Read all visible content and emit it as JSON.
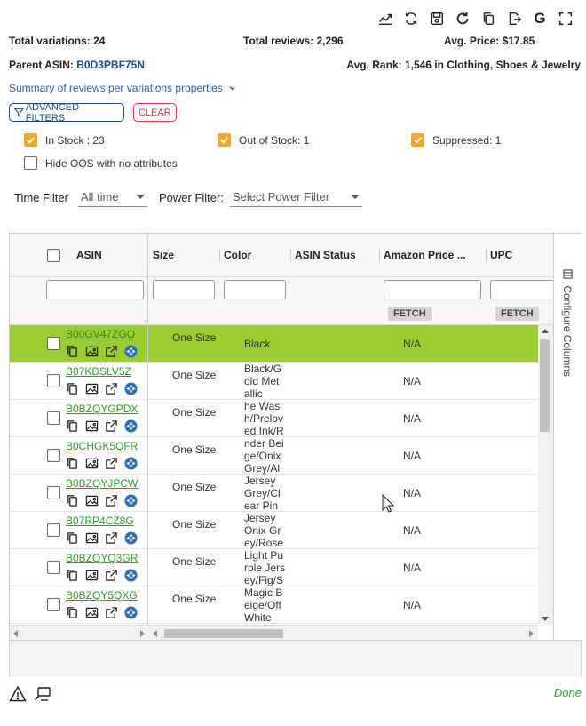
{
  "toolbar": {
    "icons": [
      "trend-chart-icon",
      "sync-icon",
      "save-icon",
      "refresh-icon",
      "copy-icon",
      "export-icon",
      "google-icon",
      "fullscreen-icon"
    ],
    "google_label": "G"
  },
  "stats": {
    "total_variations": "Total variations: 24",
    "total_reviews": "Total reviews: 2,296",
    "avg_price": "Avg. Price: $17.85",
    "parent_asin_label": "Parent ASIN: ",
    "parent_asin": "B0D3PBF75N",
    "avg_rank": "Avg. Rank: 1,546 in Clothing, Shoes & Jewelry"
  },
  "summary_link": "Summary of reviews per variations properties",
  "buttons": {
    "advanced_filters": "ADVANCED FILTERS",
    "clear": "CLEAR"
  },
  "checkboxes": {
    "in_stock": "In Stock : 23",
    "out_of_stock": "Out of Stock: 1",
    "suppressed": "Suppressed: 1",
    "hide_oos": "Hide OOS with no attributes"
  },
  "filters": {
    "time_label": "Time Filter",
    "time_value": "All time",
    "power_label": "Power Filter:",
    "power_value": "Select Power Filter"
  },
  "grid": {
    "columns": {
      "asin": "ASIN",
      "size": "Size",
      "color": "Color",
      "asin_status": "ASIN Status",
      "amazon_price": "Amazon Price ...",
      "upc": "UPC"
    },
    "fetch_label": "FETCH",
    "configure_columns": "Configure Columns",
    "rows": [
      {
        "asin": "B00GV47ZGQ",
        "size": "One Size",
        "color": "Black",
        "price": "N/A"
      },
      {
        "asin": "B07KDSLV5Z",
        "size": "One Size",
        "color": "Black/Gold Metallic",
        "price": "N/A"
      },
      {
        "asin": "B0BZQYGPDX",
        "size": "One Size",
        "color": "he Wash/Preloved Ink/R",
        "price": "N/A"
      },
      {
        "asin": "B0CHGK5QFR",
        "size": "One Size",
        "color": "nder Beige/Onix Grey/Al",
        "price": "N/A"
      },
      {
        "asin": "B0BZQYJPCW",
        "size": "One Size",
        "color": "Jersey Grey/Clear Pink/G",
        "price": "N/A"
      },
      {
        "asin": "B07RP4CZ8G",
        "size": "One Size",
        "color": "Jersey Onix Grey/Rose",
        "price": "N/A"
      },
      {
        "asin": "B0BZQYQ3GR",
        "size": "One Size",
        "color": "Light Purple Jersey/Fig/S",
        "price": "N/A"
      },
      {
        "asin": "B0BZQY5QXG",
        "size": "One Size",
        "color": "Magic Beige/Off White",
        "price": "N/A"
      }
    ]
  },
  "status": {
    "done": "Done"
  }
}
